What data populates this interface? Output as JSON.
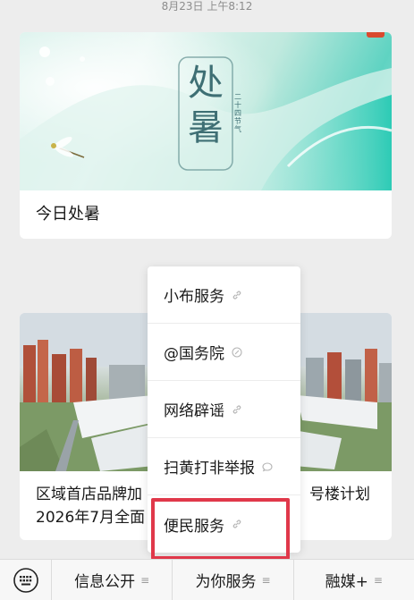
{
  "timestamp": "8月23日 上午8:12",
  "article1": {
    "cover_title": "处暑",
    "cover_subtitle": "二十四节气",
    "title": "今日处暑"
  },
  "article2": {
    "title_line1_left": "区域首店品牌加",
    "title_line1_right": "号楼计划",
    "title_line2": "2026年7月全面"
  },
  "menu": {
    "items": [
      {
        "label": "小布服务",
        "icon": "link-icon"
      },
      {
        "label": "@国务院",
        "icon": "mini-program-icon"
      },
      {
        "label": "网络辟谣",
        "icon": "link-icon"
      },
      {
        "label": "扫黄打非举报",
        "icon": "chat-icon"
      },
      {
        "label": "便民服务",
        "icon": "link-icon"
      }
    ]
  },
  "bottom_bar": {
    "keyboard_icon": "keyboard-icon",
    "tabs": [
      {
        "label": "信息公开",
        "icon": "menu-icon"
      },
      {
        "label": "为你服务",
        "icon": "menu-icon"
      },
      {
        "label": "融媒+",
        "icon": "menu-icon"
      }
    ]
  },
  "colors": {
    "highlight": "#e0384a",
    "background": "#ededed"
  }
}
